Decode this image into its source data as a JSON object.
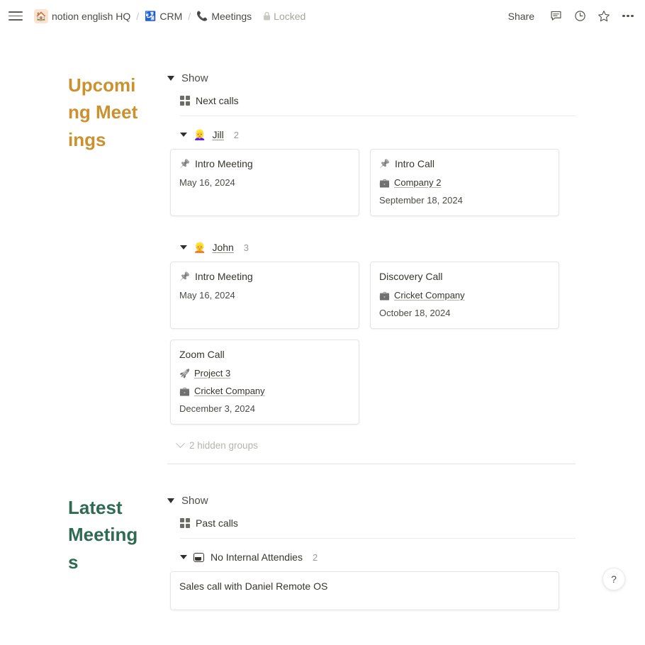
{
  "topbar": {
    "menu_icon": "hamburger-icon",
    "breadcrumbs": [
      {
        "icon": "house-icon",
        "emoji": "🏠",
        "label": "notion english HQ"
      },
      {
        "icon": "passport-icon",
        "emoji": "🛂",
        "label": "CRM"
      },
      {
        "icon": "telephone-ring-icon",
        "emoji": "📞",
        "label": "Meetings"
      }
    ],
    "separator": "/",
    "locked_label": "Locked",
    "locked_icon": "lock-icon",
    "share_label": "Share",
    "actions": [
      {
        "name": "comments-icon",
        "glyph": "🗪"
      },
      {
        "name": "history-clock-icon",
        "glyph": "◴"
      },
      {
        "name": "favorite-star-icon",
        "glyph": "☆"
      },
      {
        "name": "more-options-icon",
        "glyph": "…"
      }
    ]
  },
  "colors": {
    "upcoming_title": "#cb912f",
    "latest_title": "#2f6b53",
    "card_border": "#e6e4e0",
    "muted_text": "#9b9a95"
  },
  "sections": [
    {
      "title": "Upcoming Meetings",
      "show_label": "Show",
      "view_label": "Next calls",
      "view_icon": "gallery-grid-icon",
      "groups": [
        {
          "name": "Jill",
          "emoji": "👱‍♀️",
          "count": "2",
          "cards": [
            {
              "title": "Intro Meeting",
              "pinned": true,
              "relations": [],
              "date": "May 16, 2024"
            },
            {
              "title": "Intro Call",
              "pinned": true,
              "relations": [
                {
                  "icon": "briefcase-icon",
                  "emoji": "💼",
                  "label": "Company 2"
                }
              ],
              "date": "September 18, 2024"
            }
          ]
        },
        {
          "name": "John",
          "emoji": "👱",
          "count": "3",
          "cards": [
            {
              "title": "Intro Meeting",
              "pinned": true,
              "relations": [],
              "date": "May 16, 2024"
            },
            {
              "title": "Discovery Call",
              "pinned": false,
              "relations": [
                {
                  "icon": "briefcase-icon",
                  "emoji": "💼",
                  "label": "Cricket Company"
                }
              ],
              "date": "October 18, 2024"
            },
            {
              "title": "Zoom Call",
              "pinned": false,
              "relations": [
                {
                  "icon": "rocket-icon",
                  "emoji": "🚀",
                  "label": "Project 3"
                },
                {
                  "icon": "briefcase-icon",
                  "emoji": "💼",
                  "label": "Cricket Company"
                }
              ],
              "date": "December 3, 2024"
            }
          ]
        }
      ],
      "hidden_groups_label": "2 hidden groups"
    },
    {
      "title": "Latest Meetings",
      "show_label": "Show",
      "view_label": "Past calls",
      "view_icon": "gallery-grid-icon",
      "groups": [
        {
          "name": "No Internal Attendies",
          "icon": "inbox-tray-icon",
          "count": "2",
          "cards": [
            {
              "title": "Sales call with Daniel Remote OS",
              "pinned": false,
              "relations": [],
              "date": ""
            }
          ]
        }
      ]
    }
  ],
  "help_button": {
    "label": "?",
    "icon": "question-mark-icon"
  }
}
